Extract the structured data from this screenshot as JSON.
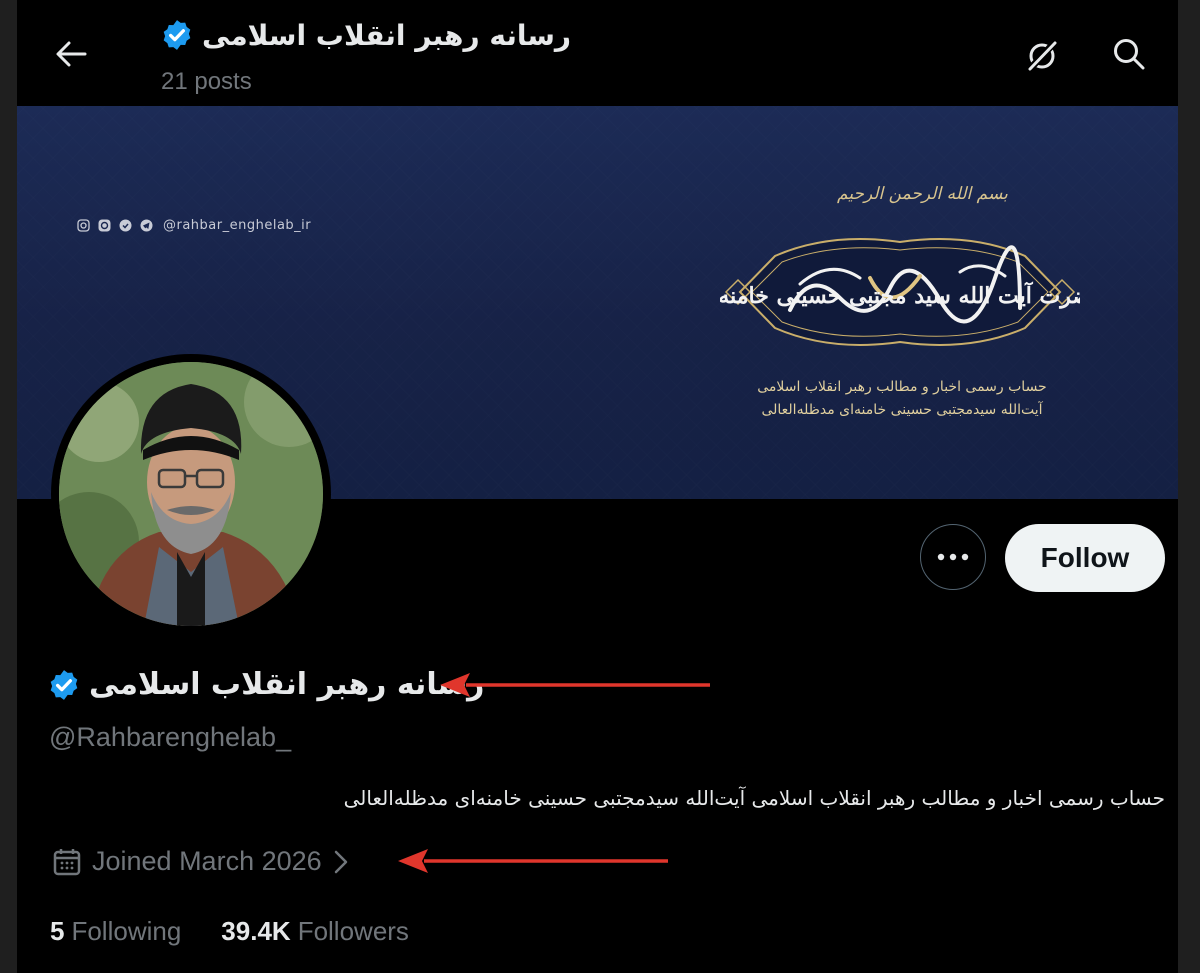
{
  "header": {
    "title": "رسانه رهبر انقلاب اسلامی",
    "post_count": "21 posts"
  },
  "banner": {
    "handle": "@rahbar_enghelab_ir",
    "basmala": "بسم الله الرحمن الرحیم",
    "calligraphy": "حضرت آیت الله سید مجتبی حسینی خامنه‌ای",
    "desc_line1": "حساب رسمی اخبار و مطالب رهبر انقلاب اسلامی",
    "desc_line2": "آیت‌الله سیدمجتبی حسینی خامنه‌ای مدظله‌العالی"
  },
  "profile": {
    "display_name": "رسانه رهبر انقلاب اسلامی",
    "handle": "@Rahbarenghelab_",
    "bio": "حساب رسمی اخبار و مطالب رهبر انقلاب اسلامی آیت‌الله سیدمجتبی حسینی خامنه‌ای مدظله‌العالی",
    "joined": "Joined March 2026",
    "following_count": "5",
    "following_label": "Following",
    "followers_count": "39.4K",
    "followers_label": "Followers"
  },
  "actions": {
    "follow_label": "Follow"
  },
  "colors": {
    "verified": "#1d9bf0",
    "annotation_arrow": "#e0362c",
    "banner_gold": "#d8c48e",
    "banner_bg": "#1a2750"
  },
  "icons": [
    "back-arrow-icon",
    "verified-badge-icon",
    "grok-icon",
    "search-icon",
    "more-icon",
    "calendar-icon",
    "chevron-right-icon"
  ]
}
